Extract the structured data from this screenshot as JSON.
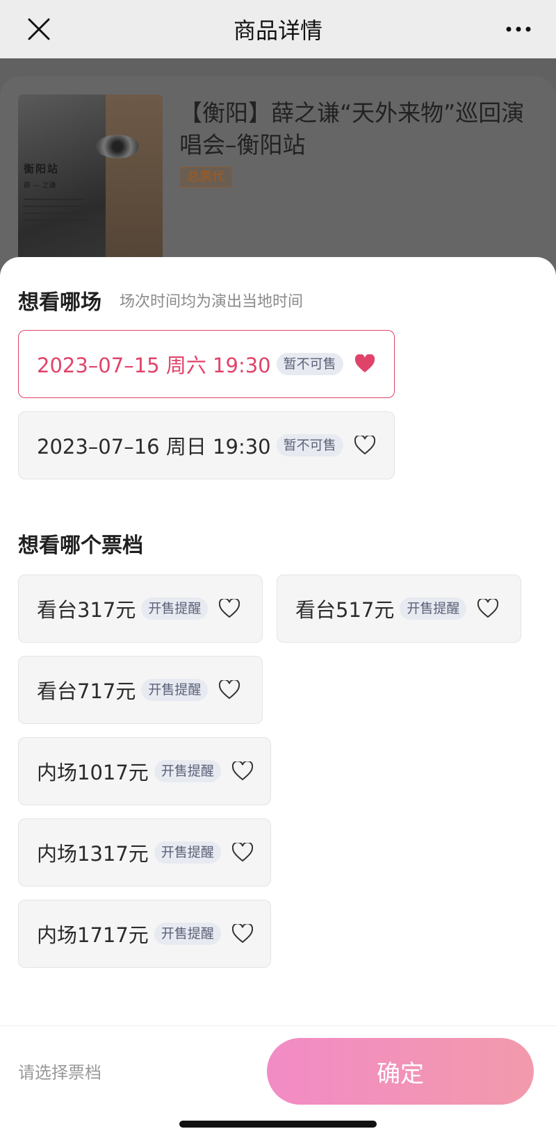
{
  "nav": {
    "title": "商品详情"
  },
  "product": {
    "title": "【衡阳】薛之谦“天外来物”巡回演唱会–衡阳站",
    "tag": "总票代",
    "poster_title": "衡阳站",
    "poster_subtitle": "薛 — 之谦"
  },
  "session_section": {
    "title": "想看哪场",
    "subtitle": "场次时间均为演出当地时间",
    "items": [
      {
        "label": "2023–07–15 周六 19:30",
        "badge": "暂不可售",
        "selected": true
      },
      {
        "label": "2023–07–16 周日 19:30",
        "badge": "暂不可售",
        "selected": false
      }
    ]
  },
  "tier_section": {
    "title": "想看哪个票档",
    "items": [
      {
        "label": "看台317元",
        "badge": "开售提醒"
      },
      {
        "label": "看台517元",
        "badge": "开售提醒"
      },
      {
        "label": "看台717元",
        "badge": "开售提醒"
      },
      {
        "label": "内场1017元",
        "badge": "开售提醒"
      },
      {
        "label": "内场1317元",
        "badge": "开售提醒"
      },
      {
        "label": "内场1717元",
        "badge": "开售提醒"
      }
    ]
  },
  "footer": {
    "hint": "请选择票档",
    "confirm_label": "确定"
  },
  "colors": {
    "accent": "#e0436a",
    "confirm_gradient_start": "#f28bc5",
    "confirm_gradient_end": "#f29aac",
    "badge_bg": "#e8eaf1"
  },
  "icons": {
    "close": "close-icon",
    "more": "more-icon",
    "heart_filled": "heart-filled-icon",
    "heart_outline": "heart-outline-icon"
  }
}
